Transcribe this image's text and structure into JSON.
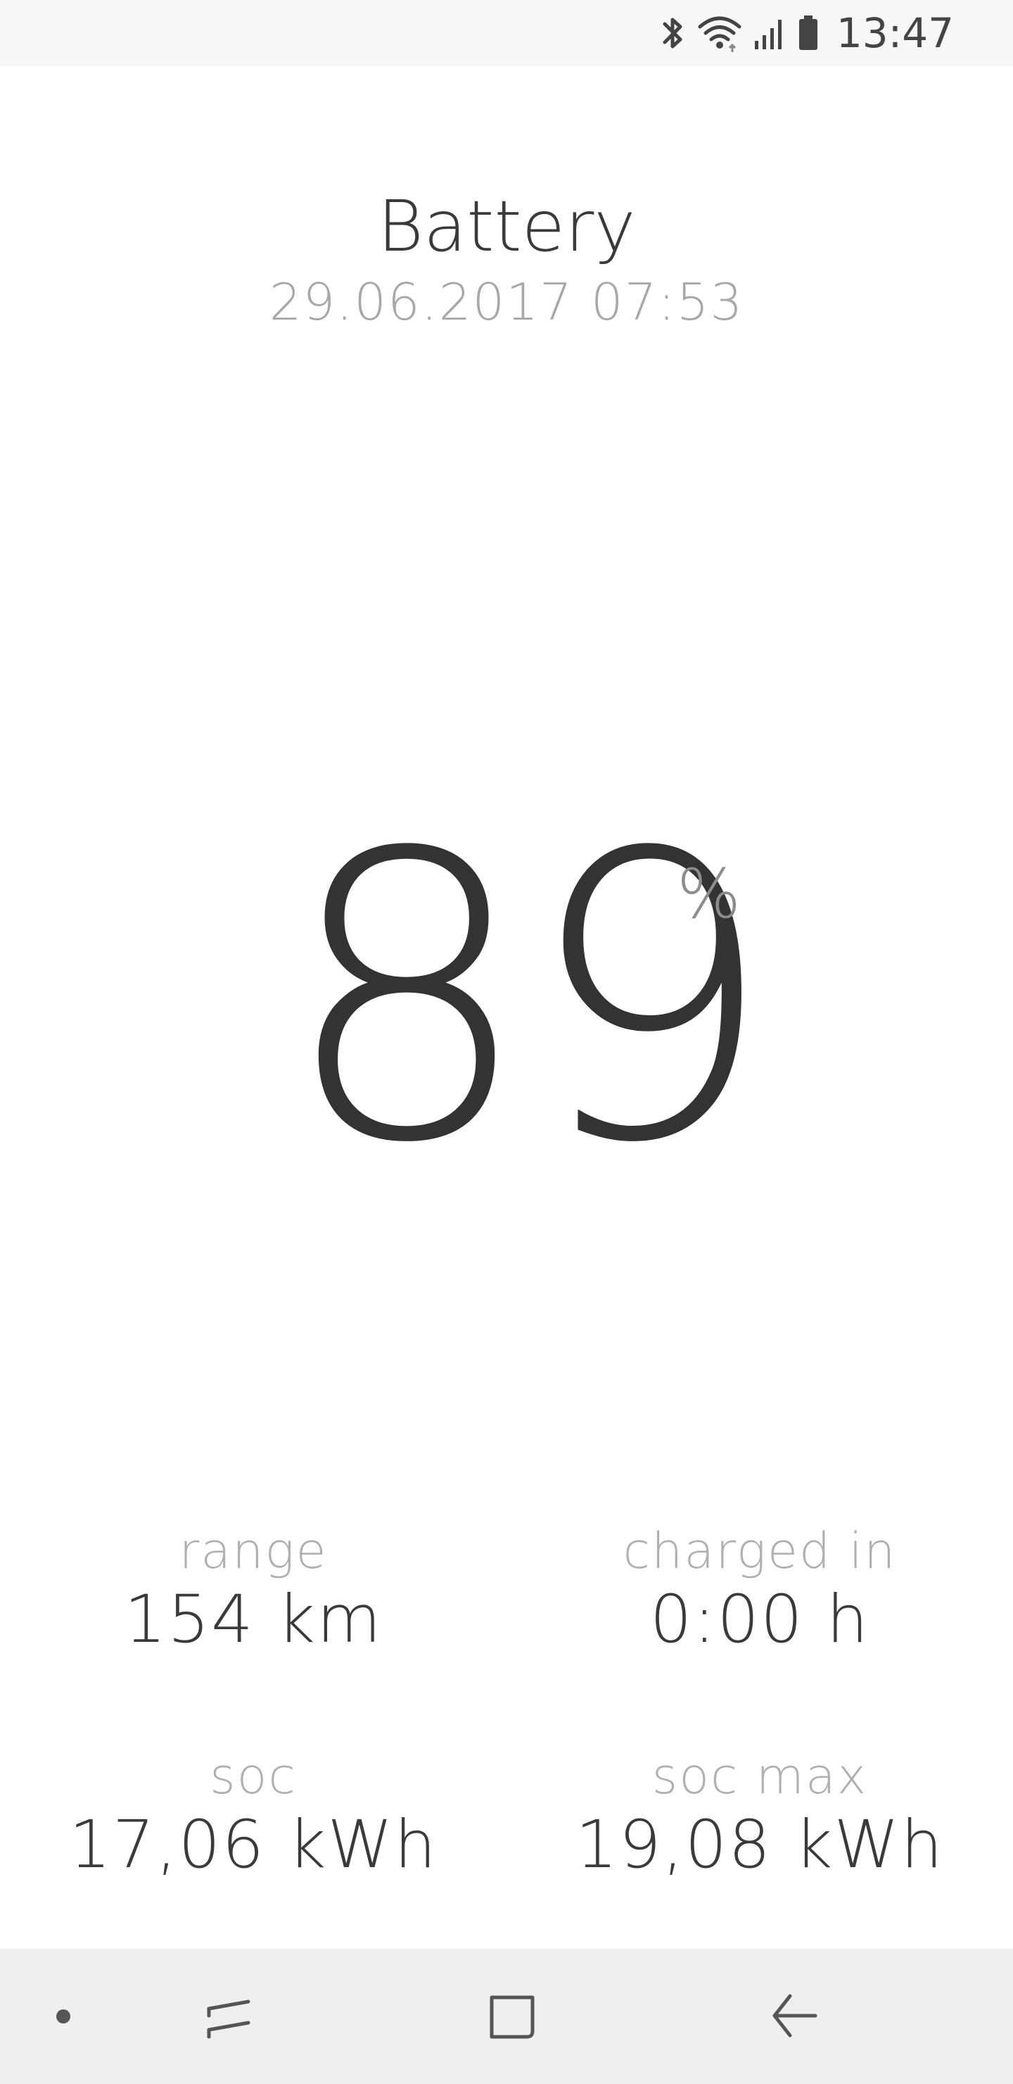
{
  "status_bar": {
    "time": "13:47",
    "icons": [
      "bluetooth-icon",
      "wifi-icon",
      "signal-icon",
      "battery-icon"
    ]
  },
  "header": {
    "title": "Battery",
    "timestamp": "29.06.2017 07:53"
  },
  "battery": {
    "value": "89",
    "unit": "%"
  },
  "stats": {
    "range": {
      "label": "range",
      "value": "154 km"
    },
    "charged_in": {
      "label": "charged in",
      "value": "0:00 h"
    },
    "soc": {
      "label": "soc",
      "value": "17,06 kWh"
    },
    "soc_max": {
      "label": "soc max",
      "value": "19,08 kWh"
    }
  },
  "nav_bar": {
    "items": [
      "dot-indicator",
      "recents-icon",
      "home-icon",
      "back-icon"
    ]
  },
  "colors": {
    "status_bar_bg": "#f7f7f7",
    "nav_bar_bg": "#efefef",
    "text_dark": "#333333",
    "text_light": "#b0b0b0"
  }
}
